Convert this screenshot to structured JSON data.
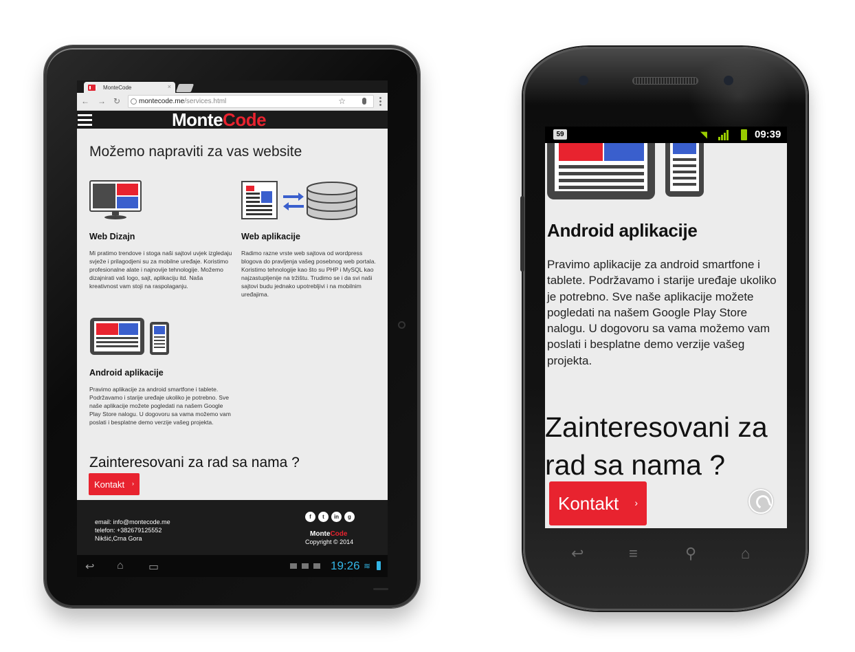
{
  "tablet": {
    "browser": {
      "tab_title": "MonteCode",
      "tab_close": "×",
      "url_host": "montecode.me",
      "url_path": "/services.html",
      "back": "←",
      "forward": "→",
      "reload": "↻",
      "bookmark": "☆"
    },
    "header": {
      "logo_part1": "Monte",
      "logo_part2": "Code"
    },
    "page_title": "Možemo napraviti za vas website",
    "services": [
      {
        "title": "Web Dizajn",
        "text": "Mi pratimo trendove i stoga naši sajtovi uvjek izgledaju svježe i prilagodjeni su za mobilne uređaje. Koristimo profesionalne alate i najnovije tehnologije. Možemo dizajnirati vaš logo, sajt, aplikaciju itd. Naša kreativnost vam stoji na raspolaganju."
      },
      {
        "title": "Web aplikacije",
        "text": "Radimo razne vrste web sajtova od wordpress blogova do pravljenja vašeg posebnog web portala. Koristimo tehnologije kao što su PHP i MySQL kao najzastupljenije na tržištu. Trudimo se i da svi naši sajtovi budu jednako upotrebljivi i na mobilnim uređajima."
      },
      {
        "title": "Android aplikacije",
        "text": "Pravimo aplikacije za android smartfone i tablete. Podržavamo i starije uređaje ukoliko je potrebno. Sve naše aplikacije možete pogledati na našem Google Play Store nalogu. U dogovoru sa vama možemo vam poslati i besplatne demo verzije vašeg projekta."
      }
    ],
    "cta_title": "Zainteresovani za rad sa nama ?",
    "cta_button": "Kontakt",
    "cta_chevron": "›",
    "footer": {
      "email": "email: info@montecode.me",
      "phone": "telefon: +382679125552",
      "location": "Nikšić,Crna Gora",
      "social": [
        "f",
        "t",
        "in",
        "g"
      ],
      "logo_part1": "Monte",
      "logo_part2": "Code",
      "copyright": "Copyright © 2014"
    },
    "system_bar": {
      "clock": "19:26",
      "back_icon": "↩",
      "home_icon": "⌂",
      "recents_icon": "▭",
      "wifi_icon": "≋"
    }
  },
  "phone": {
    "status": {
      "notification_count": "59",
      "clock": "09:39",
      "wifi_icon": "◥"
    },
    "section_title": "Android aplikacije",
    "section_text": "Pravimo aplikacije za android smartfone i tablete. Podržavamo i starije uređaje ukoliko je potrebno. Sve naše aplikacije možete pogledati na našem Google Play Store nalogu. U dogovoru sa vama možemo vam poslati i besplatne demo verzije vašeg projekta.",
    "cta_title": "Zainteresovani za rad sa nama ?",
    "cta_button": "Kontakt",
    "cta_chevron": "›",
    "softkeys": {
      "back": "↩",
      "menu": "≡",
      "search": "⚲",
      "home": "⌂"
    }
  },
  "colors": {
    "brand_red": "#e8232f",
    "accent_blue": "#3a5fcd",
    "holo_blue": "#33b5e5",
    "android_green": "#99cc00",
    "page_bg": "#ececec",
    "header_bg": "#1b1b1b"
  }
}
